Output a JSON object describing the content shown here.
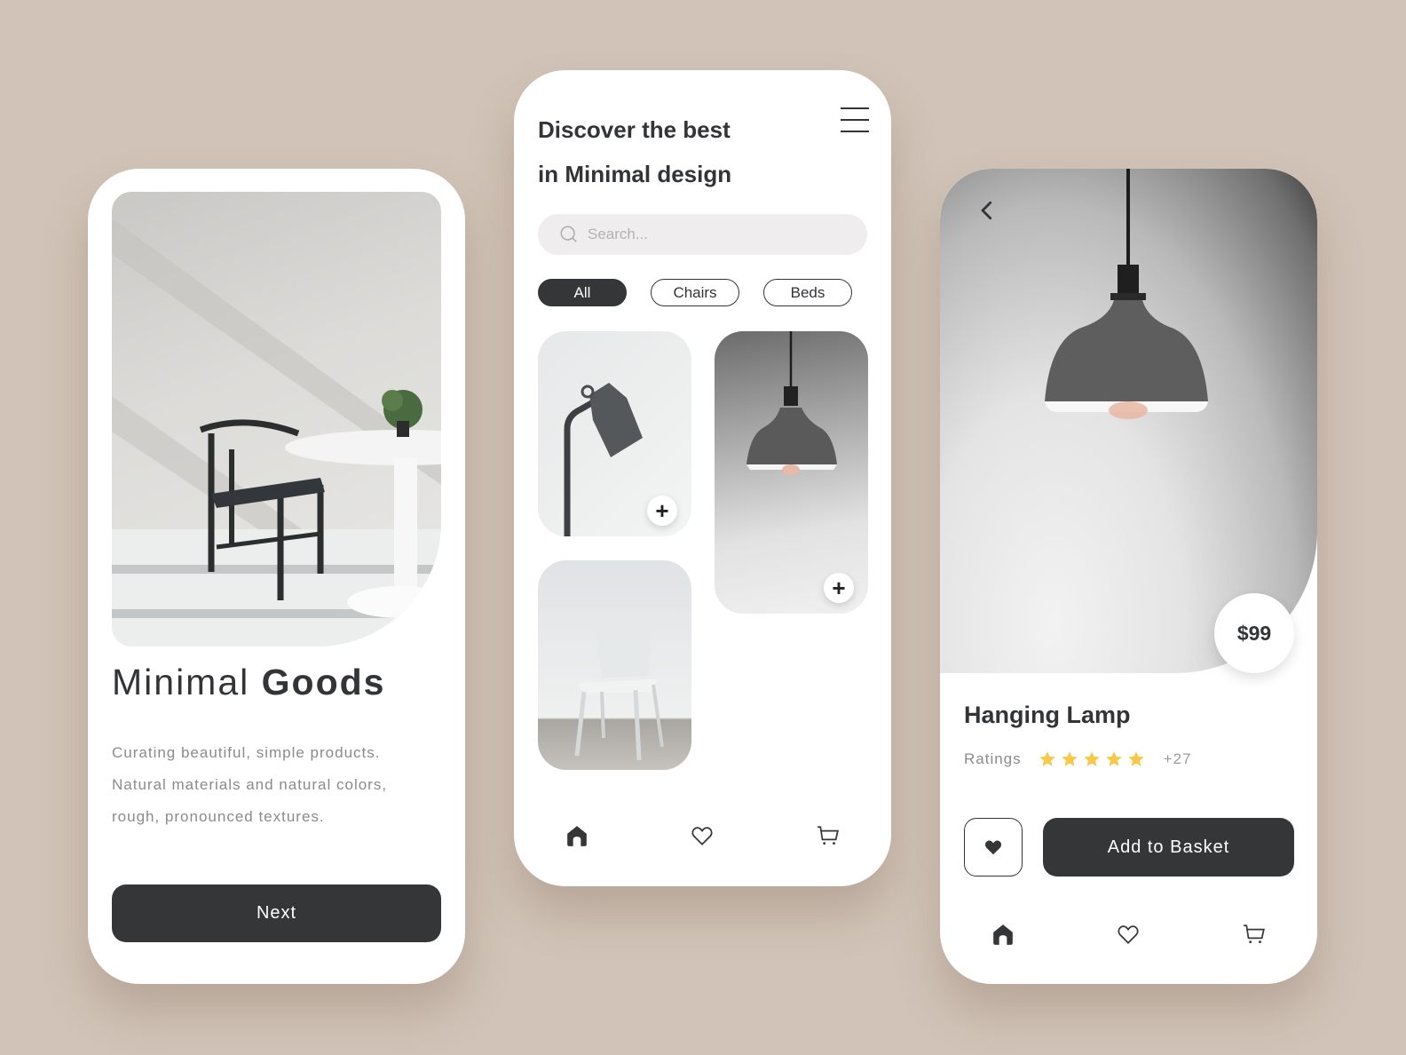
{
  "colors": {
    "background": "#d1c3b7",
    "dark": "#353638",
    "text": "#333437",
    "muted": "#8b8b8d",
    "star": "#f8c84a",
    "search_bg": "#efeded"
  },
  "onboarding": {
    "title_light": "Minimal",
    "title_bold": "Goods",
    "description": [
      "Curating beautiful, simple products.",
      "Natural materials and natural colors,",
      "rough, pronounced textures."
    ],
    "next_label": "Next",
    "hero_image": "chair-and-table-photo"
  },
  "catalog": {
    "title_line1": "Discover the best",
    "title_line2": "in Minimal design",
    "menu_icon": "hamburger-menu-icon",
    "search": {
      "placeholder": "Search...",
      "value": "",
      "icon": "search-icon"
    },
    "filters": [
      {
        "label": "All",
        "active": true
      },
      {
        "label": "Chairs",
        "active": false
      },
      {
        "label": "Beds",
        "active": false
      }
    ],
    "products": [
      {
        "name": "floor-lamp-photo",
        "add_icon": "+"
      },
      {
        "name": "pendant-lamp-photo",
        "add_icon": "+"
      },
      {
        "name": "white-chair-photo"
      }
    ],
    "nav": [
      {
        "icon": "home-icon",
        "active": true
      },
      {
        "icon": "heart-icon",
        "active": false
      },
      {
        "icon": "cart-icon",
        "active": false
      }
    ]
  },
  "detail": {
    "back_icon": "chevron-left-icon",
    "price": "$99",
    "product_name": "Hanging Lamp",
    "ratings_label": "Ratings",
    "rating_stars": 5,
    "rating_max": 5,
    "rating_count": "+27",
    "favorite_icon": "heart-filled-icon",
    "add_to_basket_label": "Add to Basket",
    "nav": [
      {
        "icon": "home-icon",
        "active": true
      },
      {
        "icon": "heart-icon",
        "active": false
      },
      {
        "icon": "cart-icon",
        "active": false
      }
    ]
  }
}
